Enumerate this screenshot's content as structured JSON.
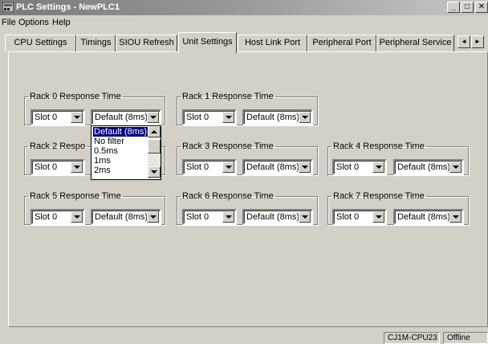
{
  "window": {
    "title": "PLC Settings - NewPLC1",
    "minimize": "_",
    "restore": "□",
    "close": "✕",
    "icon": "plc-settings-icon"
  },
  "menu": {
    "file": "File",
    "options": "Options",
    "help": "Help"
  },
  "tabs": [
    "CPU Settings",
    "Timings",
    "SIOU Refresh",
    "Unit Settings",
    "Host Link Port",
    "Peripheral Port",
    "Peripheral Service"
  ],
  "active_tab": "Unit Settings",
  "tab_scroll": {
    "left": "◄",
    "right": "►"
  },
  "racks": [
    {
      "label": "Rack 0 Response Time",
      "slot": "Slot 0",
      "time": "Default (8ms)"
    },
    {
      "label": "Rack 1 Response Time",
      "slot": "Slot 0",
      "time": "Default (8ms)"
    },
    {
      "label": "Rack 2 Respo",
      "slot": "Slot 0",
      "time": ""
    },
    {
      "label": "Rack 3 Response Time",
      "slot": "Slot 0",
      "time": "Default (8ms)"
    },
    {
      "label": "Rack 4 Response Time",
      "slot": "Slot 0",
      "time": "Default (8ms)"
    },
    {
      "label": "Rack 5 Response Time",
      "slot": "Slot 0",
      "time": "Default (8ms)"
    },
    {
      "label": "Rack 6 Response Time",
      "slot": "Slot 0",
      "time": "Default (8ms)"
    },
    {
      "label": "Rack 7 Response Time",
      "slot": "Slot 0",
      "time": "Default (8ms)"
    }
  ],
  "dropdown_options": [
    "Default (8ms)",
    "No filter",
    "0.5ms",
    "1ms",
    "2ms"
  ],
  "dropdown_selected": "Default (8ms)",
  "status": {
    "model": "CJ1M-CPU23",
    "mode": "Offline"
  }
}
